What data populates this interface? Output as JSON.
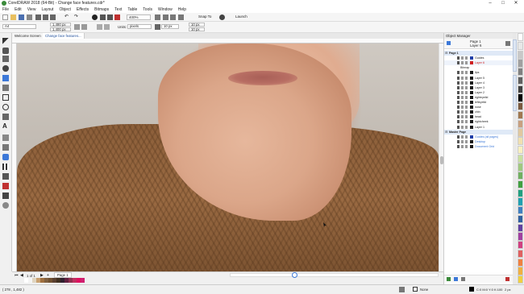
{
  "window": {
    "title": "CorelDRAW 2018 (64-Bit) - Change face features.cdr*",
    "controls": [
      "–",
      "□",
      "✕"
    ]
  },
  "menu": [
    "File",
    "Edit",
    "View",
    "Layout",
    "Object",
    "Effects",
    "Bitmaps",
    "Text",
    "Table",
    "Tools",
    "Window",
    "Help"
  ],
  "toolbar": {
    "zoom": "400%",
    "snap_to": "Snap To",
    "launch": "Launch"
  },
  "propbar": {
    "page_size": "A4",
    "width": "1,480 px",
    "height": "1,400 px",
    "units_label": "Units:",
    "units": "pixels",
    "nudge": "10 px",
    "dup_x": "10 px",
    "dup_y": "10 px"
  },
  "tabs": [
    "Welcome Screen",
    "Change face features..."
  ],
  "page": {
    "counter": "1 of 1",
    "name": "Page 1"
  },
  "status": {
    "coords": "( 278 , 1,482 )",
    "fill": "None",
    "color_model": "C:0 M:0 Y:0 K:100",
    "outline": "2 px"
  },
  "object_manager": {
    "title": "Object Manager",
    "current_page": "Page 1",
    "current_layer": "Layer 6",
    "rows": [
      {
        "label": "Page 1",
        "type": "page",
        "color": ""
      },
      {
        "label": "Guides",
        "type": "layer",
        "color": "#1f3ea8"
      },
      {
        "label": "Layer 6",
        "type": "layer",
        "color": "#d02020"
      },
      {
        "label": "Bitmap",
        "type": "object",
        "color": ""
      },
      {
        "label": "lips",
        "type": "layer",
        "color": "#1a1a1a"
      },
      {
        "label": "Layer 5",
        "type": "layer",
        "color": "#1a1a1a"
      },
      {
        "label": "Layer 4",
        "type": "layer",
        "color": "#1a1a1a"
      },
      {
        "label": "Layer 3",
        "type": "layer",
        "color": "#1a1a1a"
      },
      {
        "label": "Layer 2",
        "type": "layer",
        "color": "#1a1a1a"
      },
      {
        "label": "righteyelid",
        "type": "layer",
        "color": "#1a1a1a"
      },
      {
        "label": "lefteyelid",
        "type": "layer",
        "color": "#1a1a1a"
      },
      {
        "label": "nose",
        "type": "layer",
        "color": "#1a1a1a"
      },
      {
        "label": "chin",
        "type": "layer",
        "color": "#1a1a1a"
      },
      {
        "label": "head",
        "type": "layer",
        "color": "#1a1a1a"
      },
      {
        "label": "rightcheek",
        "type": "layer",
        "color": "#1a1a1a"
      },
      {
        "label": "Layer 1",
        "type": "layer",
        "color": "#1a1a1a"
      },
      {
        "label": "Master Page",
        "type": "page",
        "color": ""
      },
      {
        "label": "Guides (all pages)",
        "type": "master",
        "color": "#1f3ea8"
      },
      {
        "label": "Desktop",
        "type": "master",
        "color": "#1a1a1a"
      },
      {
        "label": "Document Grid",
        "type": "master",
        "color": "#1a1a1a"
      }
    ]
  },
  "dockers": [
    "Properties",
    "Object Manager"
  ],
  "colors": {
    "accent": "#3c78d8",
    "palette": [
      "#ffffff",
      "#f5f5f5",
      "#e0d5c0",
      "#c8a070",
      "#a07040",
      "#806040",
      "#705030",
      "#5a4030",
      "#403020",
      "#302030",
      "#602040",
      "#903050",
      "#c03060",
      "#e01060",
      "#d02070"
    ],
    "column_palette": [
      "#ffffff",
      "#e8e8e8",
      "#c8c8c8",
      "#a0a0a0",
      "#808080",
      "#606060",
      "#404040",
      "#000000",
      "#7a5a40",
      "#a07850",
      "#c8a080",
      "#e0c8a0",
      "#f0e0b0",
      "#f8f0c0",
      "#c8e0a0",
      "#a0c880",
      "#70b060",
      "#40a040",
      "#20a080",
      "#20a0b0",
      "#4080c0",
      "#3060a0",
      "#6040a0",
      "#a040a0",
      "#d04080",
      "#e06060",
      "#f08040",
      "#f0b040",
      "#f0d040"
    ]
  }
}
